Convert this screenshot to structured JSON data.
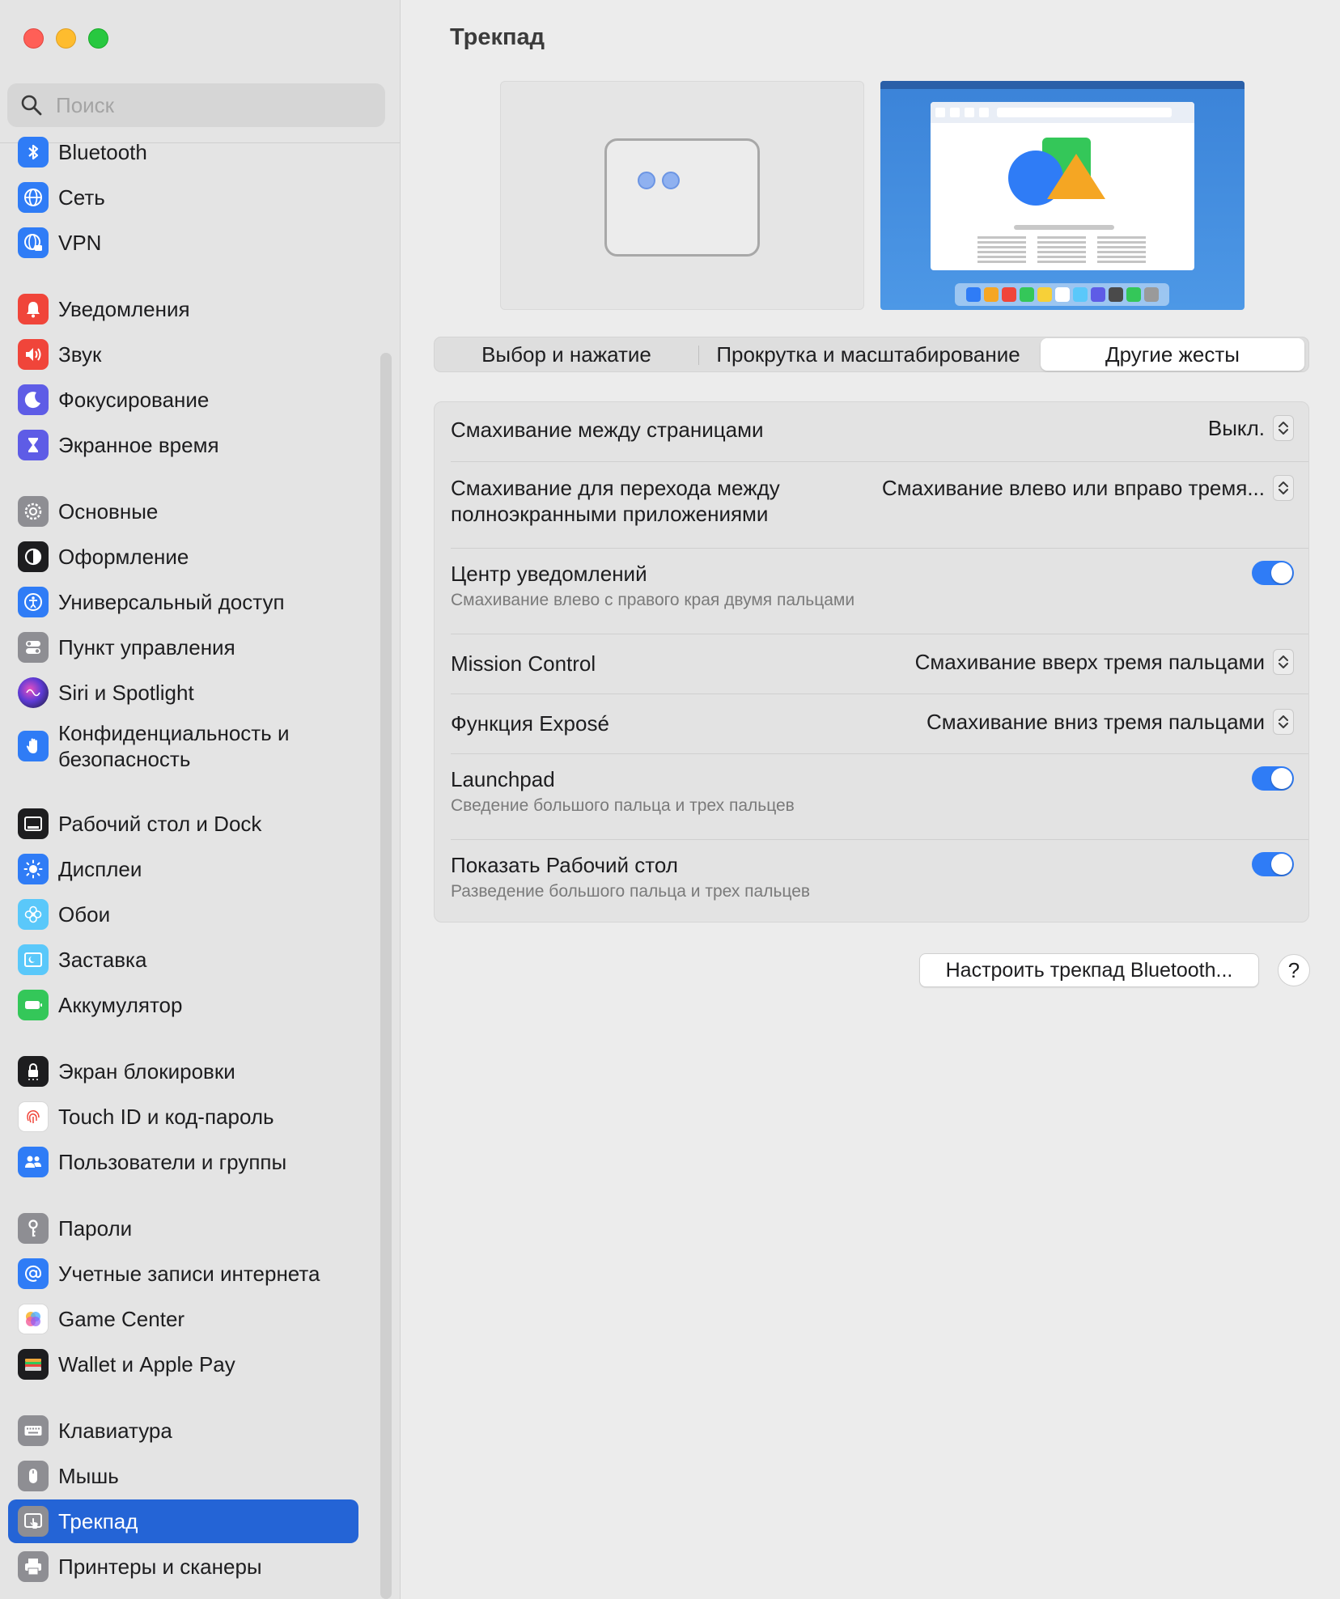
{
  "search": {
    "placeholder": "Поиск"
  },
  "sidebar": {
    "items": [
      {
        "label": "Bluetooth"
      },
      {
        "label": "Сеть"
      },
      {
        "label": "VPN"
      },
      {
        "label": "Уведомления"
      },
      {
        "label": "Звук"
      },
      {
        "label": "Фокусирование"
      },
      {
        "label": "Экранное время"
      },
      {
        "label": "Основные"
      },
      {
        "label": "Оформление"
      },
      {
        "label": "Универсальный доступ"
      },
      {
        "label": "Пункт управления"
      },
      {
        "label": "Siri и Spotlight"
      },
      {
        "label": "Конфиденциальность и безопасность"
      },
      {
        "label": "Рабочий стол и Dock"
      },
      {
        "label": "Дисплеи"
      },
      {
        "label": "Обои"
      },
      {
        "label": "Заставка"
      },
      {
        "label": "Аккумулятор"
      },
      {
        "label": "Экран блокировки"
      },
      {
        "label": "Touch ID и код-пароль"
      },
      {
        "label": "Пользователи и группы"
      },
      {
        "label": "Пароли"
      },
      {
        "label": "Учетные записи интернета"
      },
      {
        "label": "Game Center"
      },
      {
        "label": "Wallet и Apple Pay"
      },
      {
        "label": "Клавиатура"
      },
      {
        "label": "Мышь"
      },
      {
        "label": "Трекпад"
      },
      {
        "label": "Принтеры и сканеры"
      }
    ],
    "active": "Трекпад"
  },
  "main": {
    "title": "Трекпад",
    "tabs": [
      {
        "label": "Выбор и нажатие"
      },
      {
        "label": "Прокрутка и масштабирование"
      },
      {
        "label": "Другие жесты"
      }
    ],
    "active_tab": "Другие жесты",
    "settings": [
      {
        "title": "Смахивание между страницами",
        "value": "Выкл."
      },
      {
        "title": "Смахивание для перехода между полноэкранными приложениями",
        "value": "Смахивание влево или вправо тремя..."
      },
      {
        "title": "Центр уведомлений",
        "subtitle": "Смахивание влево с правого края двумя пальцами",
        "enabled": true
      },
      {
        "title": "Mission Control",
        "value": "Смахивание вверх тремя пальцами"
      },
      {
        "title": "Функция Exposé",
        "value": "Смахивание вниз тремя пальцами"
      },
      {
        "title": "Launchpad",
        "subtitle": "Сведение большого пальца и трех пальцев",
        "enabled": true
      },
      {
        "title": "Показать Рабочий стол",
        "subtitle": "Разведение большого пальца и трех пальцев",
        "enabled": true
      }
    ],
    "bluetooth_button": "Настроить трекпад Bluetooth...",
    "help_button": "?"
  },
  "colors": {
    "accent": "#2464d6",
    "toggle_on": "#2f7cf6"
  }
}
